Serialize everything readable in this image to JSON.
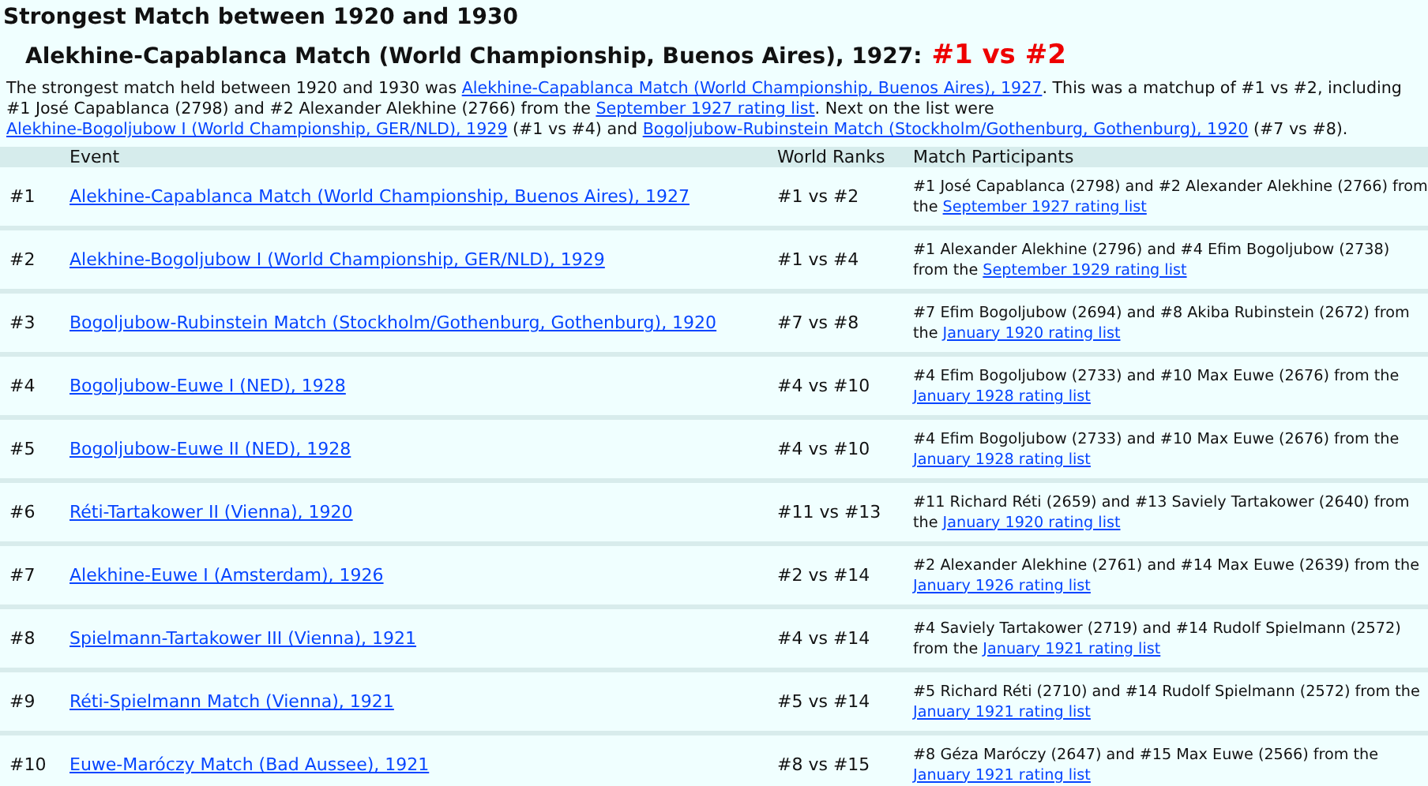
{
  "title": "Strongest Match between 1920 and 1930",
  "subtitle": {
    "text": "Alekhine-Capablanca Match (World Championship, Buenos Aires), 1927:",
    "ranks": "#1 vs #2"
  },
  "summary": [
    {
      "kind": "text",
      "text": "The strongest match held between 1920 and 1930 was "
    },
    {
      "kind": "link",
      "text": "Alekhine-Capablanca Match (World Championship, Buenos Aires), 1927"
    },
    {
      "kind": "text",
      "text": ". This was a matchup of #1 vs #2, including #1 José Capablanca (2798) and #2 Alexander Alekhine (2766) from the "
    },
    {
      "kind": "link",
      "text": "September 1927 rating list"
    },
    {
      "kind": "text",
      "text": ". Next on the list were "
    },
    {
      "kind": "link",
      "text": "Alekhine-Bogoljubow I (World Championship, GER/NLD), 1929"
    },
    {
      "kind": "text",
      "text": " (#1 vs #4) and "
    },
    {
      "kind": "link",
      "text": "Bogoljubow-Rubinstein Match (Stockholm/Gothenburg, Gothenburg), 1920"
    },
    {
      "kind": "text",
      "text": " (#7 vs #8)."
    }
  ],
  "table": {
    "columns": [
      "Event",
      "World Ranks",
      "Match Participants"
    ],
    "rows": [
      {
        "rank": "#1",
        "event": "Alekhine-Capablanca Match (World Championship, Buenos Aires), 1927",
        "world_ranks": "#1 vs #2",
        "participants": "#1 José Capablanca (2798) and #2 Alexander Alekhine (2766) from the",
        "rating_list": "September 1927 rating list"
      },
      {
        "rank": "#2",
        "event": "Alekhine-Bogoljubow I (World Championship, GER/NLD), 1929",
        "world_ranks": "#1 vs #4",
        "participants": "#1 Alexander Alekhine (2796) and #4 Efim Bogoljubow (2738) from the",
        "rating_list": "September 1929 rating list"
      },
      {
        "rank": "#3",
        "event": "Bogoljubow-Rubinstein Match (Stockholm/Gothenburg, Gothenburg), 1920",
        "world_ranks": "#7 vs #8",
        "participants": "#7 Efim Bogoljubow (2694) and #8 Akiba Rubinstein (2672) from the",
        "rating_list": "January 1920 rating list"
      },
      {
        "rank": "#4",
        "event": "Bogoljubow-Euwe I (NED), 1928",
        "world_ranks": "#4 vs #10",
        "participants": "#4 Efim Bogoljubow (2733) and #10 Max Euwe (2676) from the",
        "rating_list": "January 1928 rating list"
      },
      {
        "rank": "#5",
        "event": "Bogoljubow-Euwe II (NED), 1928",
        "world_ranks": "#4 vs #10",
        "participants": "#4 Efim Bogoljubow (2733) and #10 Max Euwe (2676) from the",
        "rating_list": "January 1928 rating list"
      },
      {
        "rank": "#6",
        "event": "Réti-Tartakower II (Vienna), 1920",
        "world_ranks": "#11 vs #13",
        "participants": "#11 Richard Réti (2659) and #13 Saviely Tartakower (2640) from the",
        "rating_list": "January 1920 rating list"
      },
      {
        "rank": "#7",
        "event": "Alekhine-Euwe I (Amsterdam), 1926",
        "world_ranks": "#2 vs #14",
        "participants": "#2 Alexander Alekhine (2761) and #14 Max Euwe (2639) from the",
        "rating_list": "January 1926 rating list"
      },
      {
        "rank": "#8",
        "event": "Spielmann-Tartakower III (Vienna), 1921",
        "world_ranks": "#4 vs #14",
        "participants": "#4 Saviely Tartakower (2719) and #14 Rudolf Spielmann (2572) from the",
        "rating_list": "January 1921 rating list"
      },
      {
        "rank": "#9",
        "event": "Réti-Spielmann Match (Vienna), 1921",
        "world_ranks": "#5 vs #14",
        "participants": "#5 Richard Réti (2710) and #14 Rudolf Spielmann (2572) from the",
        "rating_list": "January 1921 rating list"
      },
      {
        "rank": "#10",
        "event": "Euwe-Maróczy Match (Bad Aussee), 1921",
        "world_ranks": "#8 vs #15",
        "participants": "#8 Géza Maróczy (2647) and #15 Max Euwe (2566) from the",
        "rating_list": "January 1921 rating list"
      }
    ]
  }
}
